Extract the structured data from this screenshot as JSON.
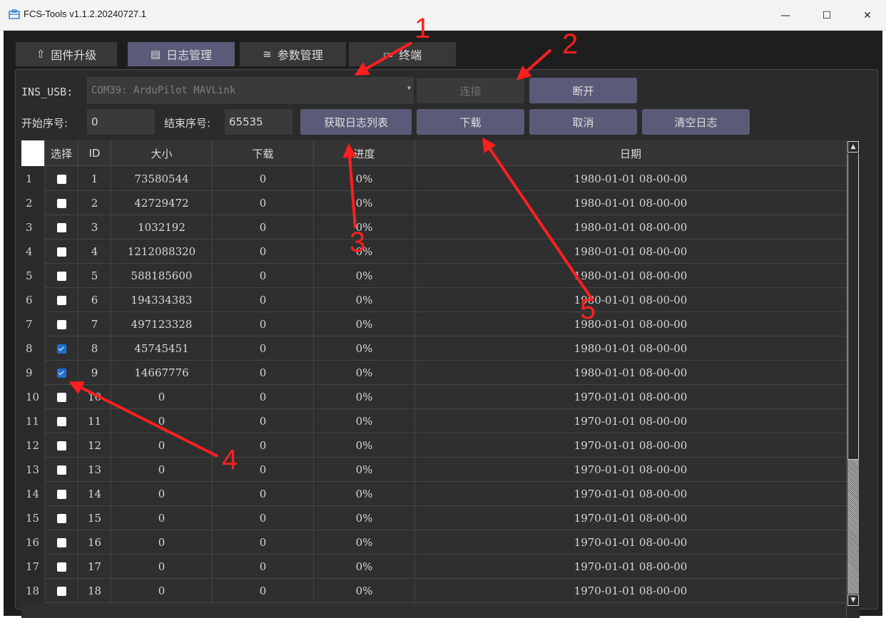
{
  "window": {
    "title": "FCS-Tools v1.1.2.20240727.1",
    "controls": {
      "minimize": "—",
      "maximize": "☐",
      "close": "✕"
    }
  },
  "tabs": [
    {
      "icon": "⇧",
      "label": "固件升级",
      "active": false
    },
    {
      "icon": "▤",
      "label": "日志管理",
      "active": true
    },
    {
      "icon": "≅",
      "label": "参数管理",
      "active": false
    },
    {
      "icon": "▭",
      "label": "终端",
      "active": false
    }
  ],
  "connection": {
    "port_label": "INS_USB:",
    "port_value": "COM39: ArduPilot MAVLink",
    "connect_label": "连接",
    "disconnect_label": "断开"
  },
  "range": {
    "start_label": "开始序号:",
    "start_value": "0",
    "end_label": "结束序号:",
    "end_value": "65535"
  },
  "actions": {
    "get_list": "获取日志列表",
    "download": "下载",
    "cancel": "取消",
    "clear": "清空日志"
  },
  "table": {
    "columns": [
      "选择",
      "ID",
      "大小",
      "下载",
      "进度",
      "日期"
    ],
    "rows": [
      {
        "n": "1",
        "checked": false,
        "id": "1",
        "size": "73580544",
        "dl": "0",
        "progress": "0%",
        "date": "1980-01-01 08-00-00"
      },
      {
        "n": "2",
        "checked": false,
        "id": "2",
        "size": "42729472",
        "dl": "0",
        "progress": "0%",
        "date": "1980-01-01 08-00-00"
      },
      {
        "n": "3",
        "checked": false,
        "id": "3",
        "size": "1032192",
        "dl": "0",
        "progress": "0%",
        "date": "1980-01-01 08-00-00"
      },
      {
        "n": "4",
        "checked": false,
        "id": "4",
        "size": "1212088320",
        "dl": "0",
        "progress": "0%",
        "date": "1980-01-01 08-00-00"
      },
      {
        "n": "5",
        "checked": false,
        "id": "5",
        "size": "588185600",
        "dl": "0",
        "progress": "0%",
        "date": "1980-01-01 08-00-00"
      },
      {
        "n": "6",
        "checked": false,
        "id": "6",
        "size": "194334383",
        "dl": "0",
        "progress": "0%",
        "date": "1980-01-01 08-00-00"
      },
      {
        "n": "7",
        "checked": false,
        "id": "7",
        "size": "497123328",
        "dl": "0",
        "progress": "0%",
        "date": "1980-01-01 08-00-00"
      },
      {
        "n": "8",
        "checked": true,
        "id": "8",
        "size": "45745451",
        "dl": "0",
        "progress": "0%",
        "date": "1980-01-01 08-00-00"
      },
      {
        "n": "9",
        "checked": true,
        "id": "9",
        "size": "14667776",
        "dl": "0",
        "progress": "0%",
        "date": "1980-01-01 08-00-00"
      },
      {
        "n": "10",
        "checked": false,
        "id": "10",
        "size": "0",
        "dl": "0",
        "progress": "0%",
        "date": "1970-01-01 08-00-00"
      },
      {
        "n": "11",
        "checked": false,
        "id": "11",
        "size": "0",
        "dl": "0",
        "progress": "0%",
        "date": "1970-01-01 08-00-00"
      },
      {
        "n": "12",
        "checked": false,
        "id": "12",
        "size": "0",
        "dl": "0",
        "progress": "0%",
        "date": "1970-01-01 08-00-00"
      },
      {
        "n": "13",
        "checked": false,
        "id": "13",
        "size": "0",
        "dl": "0",
        "progress": "0%",
        "date": "1970-01-01 08-00-00"
      },
      {
        "n": "14",
        "checked": false,
        "id": "14",
        "size": "0",
        "dl": "0",
        "progress": "0%",
        "date": "1970-01-01 08-00-00"
      },
      {
        "n": "15",
        "checked": false,
        "id": "15",
        "size": "0",
        "dl": "0",
        "progress": "0%",
        "date": "1970-01-01 08-00-00"
      },
      {
        "n": "16",
        "checked": false,
        "id": "16",
        "size": "0",
        "dl": "0",
        "progress": "0%",
        "date": "1970-01-01 08-00-00"
      },
      {
        "n": "17",
        "checked": false,
        "id": "17",
        "size": "0",
        "dl": "0",
        "progress": "0%",
        "date": "1970-01-01 08-00-00"
      },
      {
        "n": "18",
        "checked": false,
        "id": "18",
        "size": "0",
        "dl": "0",
        "progress": "0%",
        "date": "1970-01-01 08-00-00"
      }
    ]
  },
  "annotations": {
    "n1": "1",
    "n2": "2",
    "n3": "3",
    "n4": "4",
    "n5": "5"
  },
  "colors": {
    "accent": "#5a5b78",
    "annotation": "#ff1f1f",
    "checkbox_checked": "#1f6fd1"
  }
}
